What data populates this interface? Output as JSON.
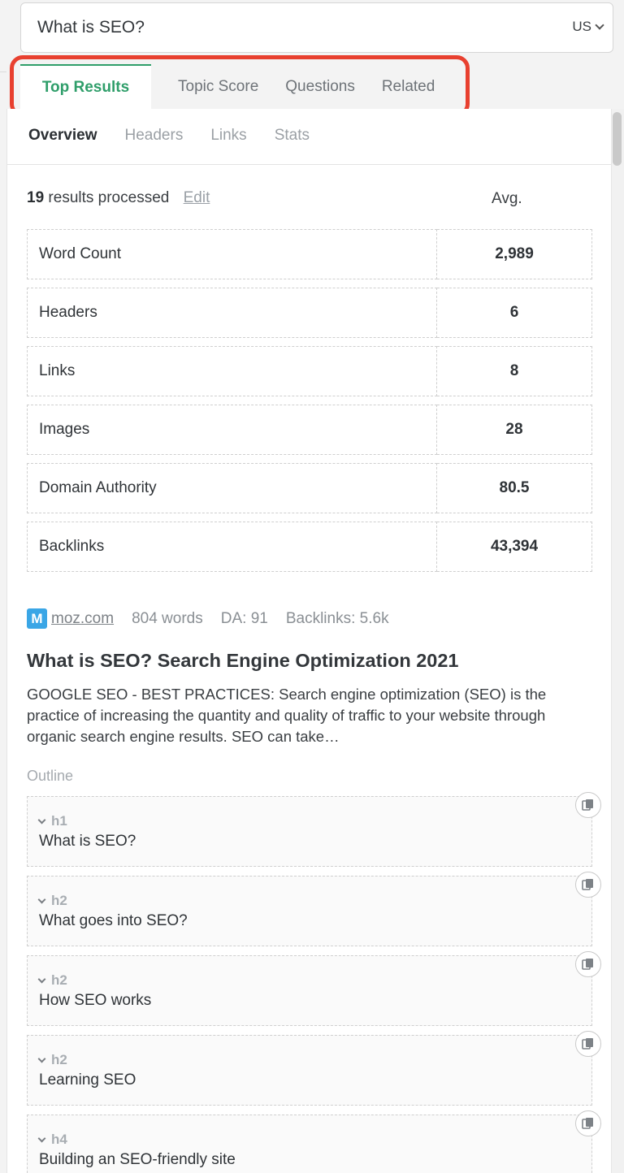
{
  "search": {
    "value": "What is SEO?",
    "country": "US"
  },
  "main_tabs": [
    {
      "label": "Top Results",
      "active": true
    },
    {
      "label": "Topic Score"
    },
    {
      "label": "Questions"
    },
    {
      "label": "Related"
    }
  ],
  "sub_tabs": [
    {
      "label": "Overview",
      "active": true
    },
    {
      "label": "Headers"
    },
    {
      "label": "Links"
    },
    {
      "label": "Stats"
    }
  ],
  "summary": {
    "count": "19",
    "text": "results processed",
    "edit_label": "Edit",
    "avg_label": "Avg."
  },
  "stats": [
    {
      "name": "Word Count",
      "value": "2,989"
    },
    {
      "name": "Headers",
      "value": "6"
    },
    {
      "name": "Links",
      "value": "8"
    },
    {
      "name": "Images",
      "value": "28"
    },
    {
      "name": "Domain Authority",
      "value": "80.5"
    },
    {
      "name": "Backlinks",
      "value": "43,394"
    }
  ],
  "result": {
    "logo_letter": "M",
    "domain": "moz.com",
    "words": "804 words",
    "da": "DA: 91",
    "backlinks": "Backlinks: 5.6k",
    "title": "What is SEO? Search Engine Optimization 2021",
    "snippet": "GOOGLE SEO - BEST PRACTICES: Search engine optimization (SEO) is the practice of increasing the quantity and quality of traffic to your website through organic search engine results. SEO can take…",
    "outline_label": "Outline",
    "outline": [
      {
        "level": "h1",
        "text": "What is SEO?"
      },
      {
        "level": "h2",
        "text": "What goes into SEO?"
      },
      {
        "level": "h2",
        "text": "How SEO works"
      },
      {
        "level": "h2",
        "text": "Learning SEO"
      },
      {
        "level": "h4",
        "text": "Building an SEO-friendly site"
      }
    ]
  },
  "colors": {
    "accent": "#2f9e6a",
    "highlight": "#e8402f",
    "moz_blue": "#3aa6e6"
  }
}
